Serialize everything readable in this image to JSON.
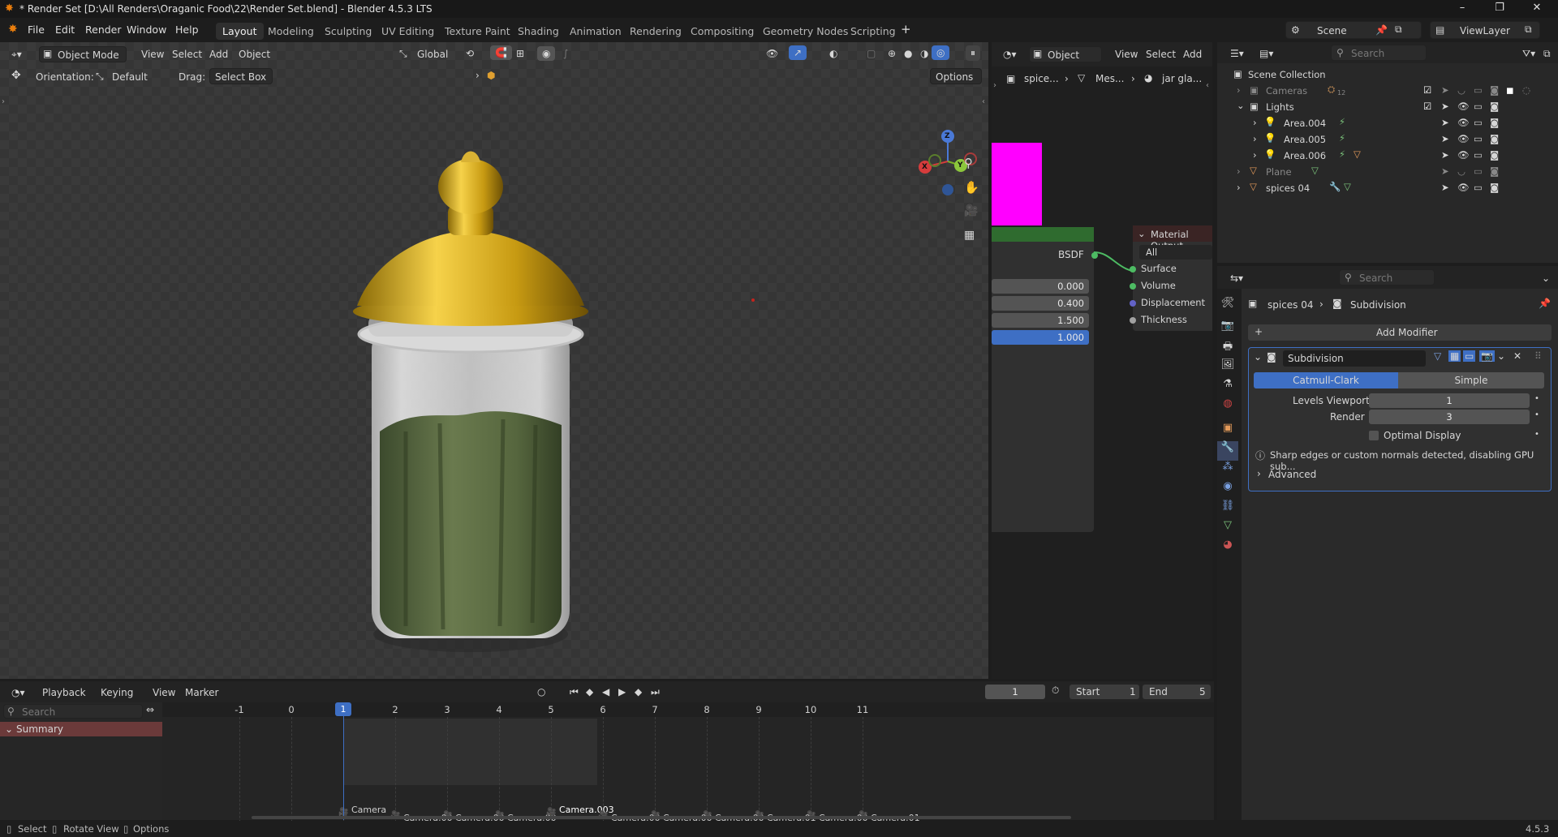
{
  "title_bar": {
    "title": "* Render Set [D:\\All Renders\\Oraganic Food\\22\\Render Set.blend] - Blender 4.5.3 LTS",
    "minimize": "–",
    "restore": "❐",
    "close": "✕"
  },
  "menu": {
    "items": [
      "File",
      "Edit",
      "Render",
      "Window",
      "Help"
    ]
  },
  "workspaces": {
    "tabs": [
      "Layout",
      "Modeling",
      "Sculpting",
      "UV Editing",
      "Texture Paint",
      "Shading",
      "Animation",
      "Rendering",
      "Compositing",
      "Geometry Nodes",
      "Scripting"
    ],
    "active": "Layout",
    "add": "+"
  },
  "top_right": {
    "scene": "Scene",
    "view_layer": "ViewLayer"
  },
  "viewport": {
    "mode": "Object Mode",
    "menus": [
      "View",
      "Select",
      "Add",
      "Object"
    ],
    "transform_orientation": "Global",
    "orientation_label": "Orientation:",
    "orientation_value": "Default",
    "drag_label": "Drag:",
    "drag_value": "Select Box",
    "options": "Options",
    "gizmo_axes": {
      "x": "X",
      "y": "Y",
      "z": "Z"
    }
  },
  "shader_editor": {
    "object_menu": "Object",
    "menus": [
      "View",
      "Select",
      "Add"
    ],
    "breadcrumb": [
      "spice...",
      "Mes...",
      "jar gla..."
    ],
    "bsdf_label": "BSDF",
    "values": [
      "0.000",
      "0.400",
      "1.500",
      "1.000"
    ],
    "material_output": {
      "title": "Material Output",
      "target": "All",
      "inputs": [
        "Surface",
        "Volume",
        "Displacement",
        "Thickness"
      ]
    },
    "colors": {
      "magenta": "#ff00ff",
      "node_header": "#2f6b2f",
      "active_slider": "#3e6fc4"
    }
  },
  "outliner": {
    "search_placeholder": "Search",
    "root": "Scene Collection",
    "rows": [
      {
        "name": "Cameras",
        "level": 1,
        "expand": "›",
        "dim": true,
        "extra": "12"
      },
      {
        "name": "Lights",
        "level": 1,
        "expand": "⌄",
        "dim": false
      },
      {
        "name": "Area.004",
        "level": 2,
        "expand": "›",
        "dim": false
      },
      {
        "name": "Area.005",
        "level": 2,
        "expand": "›",
        "dim": false
      },
      {
        "name": "Area.006",
        "level": 2,
        "expand": "›",
        "dim": false
      },
      {
        "name": "Plane",
        "level": 1,
        "expand": "›",
        "dim": true
      },
      {
        "name": "spices 04",
        "level": 1,
        "expand": "›",
        "dim": false
      }
    ]
  },
  "properties": {
    "search_placeholder": "Search",
    "breadcrumb_object": "spices 04",
    "breadcrumb_modifier": "Subdivision",
    "add_modifier": "Add Modifier",
    "modifier_name": "Subdivision",
    "method_options": [
      "Catmull-Clark",
      "Simple"
    ],
    "method_active": "Catmull-Clark",
    "levels_viewport_label": "Levels Viewport",
    "levels_viewport": "1",
    "render_label": "Render",
    "render_levels": "3",
    "optimal_display": "Optimal Display",
    "warning": "Sharp edges or custom normals detected, disabling GPU sub...",
    "advanced": "Advanced"
  },
  "timeline": {
    "menus": [
      "Playback",
      "Keying",
      "View",
      "Marker"
    ],
    "current_frame": "1",
    "start_label": "Start",
    "start": "1",
    "end_label": "End",
    "end": "5",
    "search_placeholder": "Search",
    "summary": "Summary",
    "frame_numbers": [
      "-1",
      "0",
      "1",
      "2",
      "3",
      "4",
      "5",
      "6",
      "7",
      "8",
      "9",
      "10",
      "11"
    ],
    "markers": [
      "Camera",
      "Camera.00",
      "Camera.00",
      "Camera.00",
      "Camera.003",
      "Camera.00",
      "Camera.00",
      "Camera.00",
      "Camera.01",
      "Camera.00",
      "Camera.01"
    ]
  },
  "status_bar": {
    "items": [
      "Select",
      "Rotate View",
      "Options"
    ],
    "version": "4.5.3"
  }
}
